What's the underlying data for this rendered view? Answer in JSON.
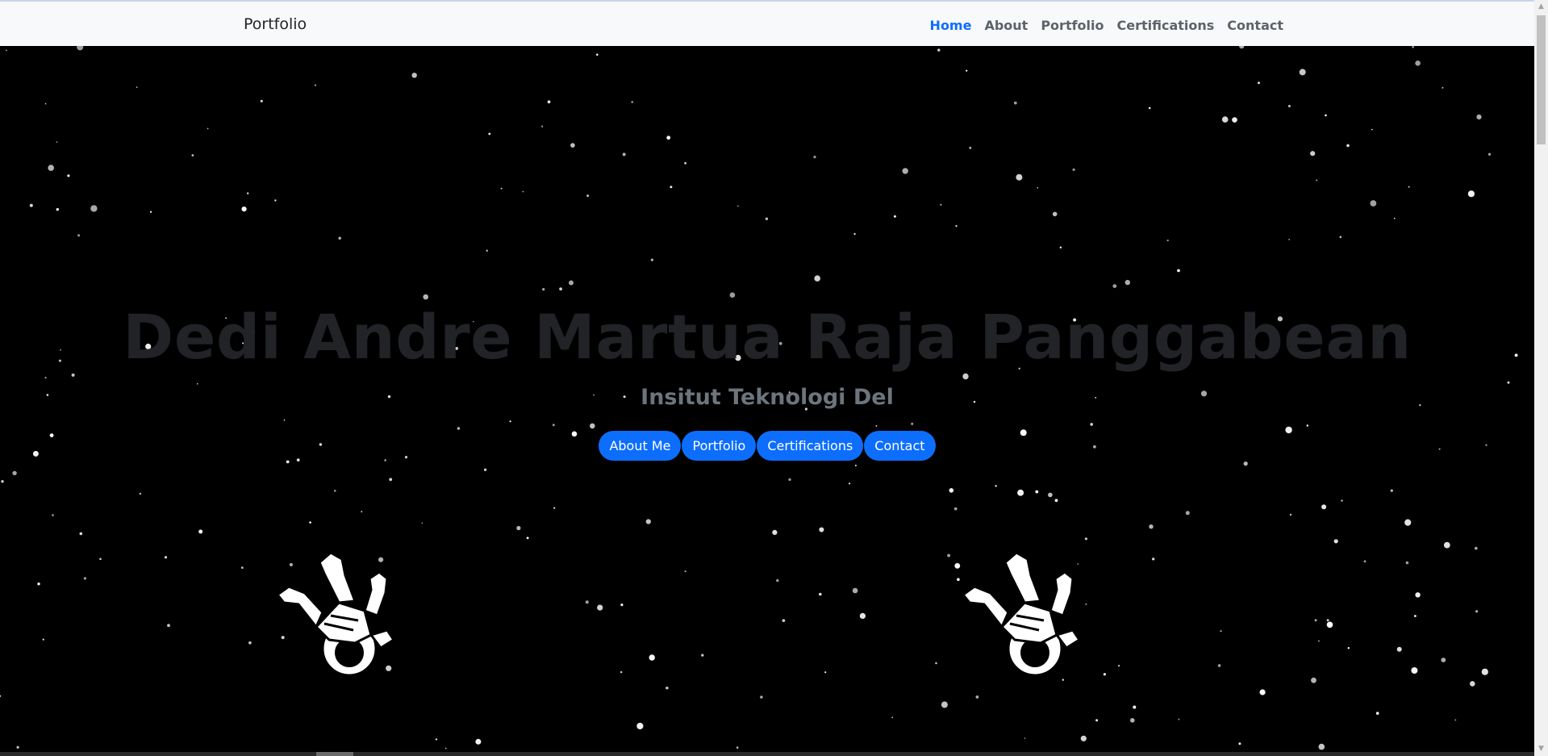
{
  "navbar": {
    "brand": "Portfolio",
    "links": [
      {
        "label": "Home",
        "active": true
      },
      {
        "label": "About",
        "active": false
      },
      {
        "label": "Portfolio",
        "active": false
      },
      {
        "label": "Certifications",
        "active": false
      },
      {
        "label": "Contact",
        "active": false
      }
    ]
  },
  "hero": {
    "title": "Dedi Andre Martua Raja Panggabean",
    "subtitle": "Insitut Teknologi Del",
    "buttons": [
      "About Me",
      "Portfolio",
      "Certifications",
      "Contact"
    ],
    "background_color": "#000000",
    "decoration": "astronaut-icon"
  },
  "colors": {
    "primary": "#0d6efd",
    "navbar_bg": "#f8f9fa",
    "title": "#212327",
    "subtitle": "#6c757d"
  }
}
